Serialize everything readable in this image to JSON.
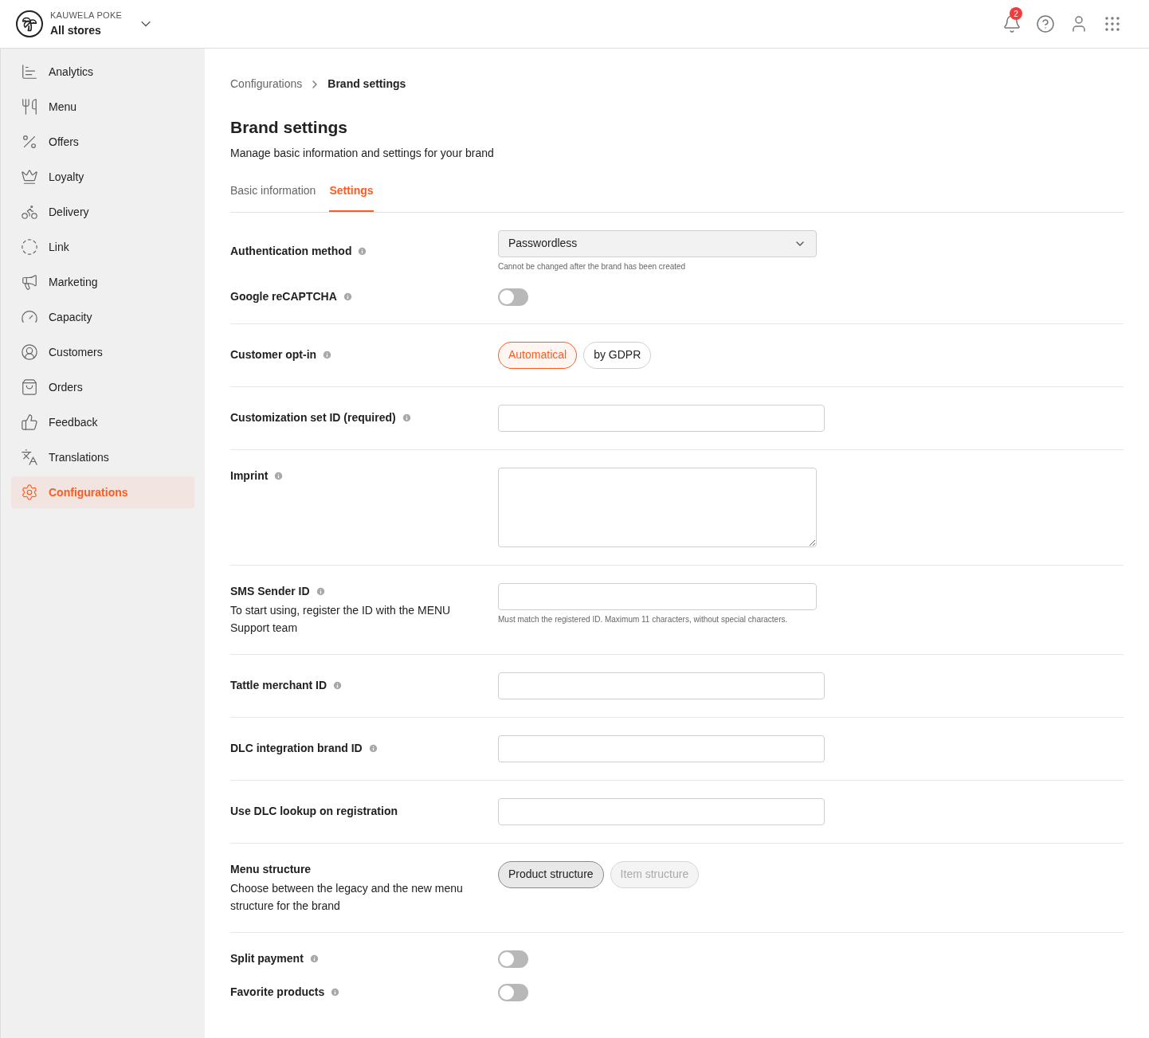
{
  "header": {
    "brand": "KAUWELA POKE",
    "store": "All stores",
    "notifications": "2"
  },
  "sidebar": {
    "items": [
      {
        "label": "Analytics",
        "selected": false
      },
      {
        "label": "Menu",
        "selected": false
      },
      {
        "label": "Offers",
        "selected": false
      },
      {
        "label": "Loyalty",
        "selected": false
      },
      {
        "label": "Delivery",
        "selected": false
      },
      {
        "label": "Link",
        "selected": false
      },
      {
        "label": "Marketing",
        "selected": false
      },
      {
        "label": "Capacity",
        "selected": false
      },
      {
        "label": "Customers",
        "selected": false
      },
      {
        "label": "Orders",
        "selected": false
      },
      {
        "label": "Feedback",
        "selected": false
      },
      {
        "label": "Translations",
        "selected": false
      },
      {
        "label": "Configurations",
        "selected": true
      }
    ]
  },
  "breadcrumb": [
    "Configurations",
    "Brand settings"
  ],
  "page": {
    "title": "Brand settings",
    "subtitle": "Manage basic information and settings for your brand"
  },
  "tabs": [
    {
      "label": "Basic information",
      "selected": false
    },
    {
      "label": "Settings",
      "selected": true
    }
  ],
  "sections": [
    {
      "rows": [
        {
          "kind": "select",
          "label": "Authentication method",
          "info": true,
          "value": "Passwordless",
          "hint": "Cannot be changed after the brand has been created"
        },
        {
          "kind": "toggle",
          "label": "Google reCAPTCHA",
          "info": true,
          "on": false
        }
      ]
    },
    {
      "rows": [
        {
          "kind": "choice",
          "label": "Customer opt-in",
          "info": true,
          "options": [
            {
              "label": "Automatical",
              "selected": true
            },
            {
              "label": "by GDPR",
              "selected": false
            }
          ]
        }
      ]
    },
    {
      "rows": [
        {
          "kind": "input",
          "label": "Customization set ID (required)",
          "info": true
        }
      ]
    },
    {
      "rows": [
        {
          "kind": "textarea",
          "label": "Imprint",
          "info": true
        }
      ]
    },
    {
      "rows": [
        {
          "kind": "input",
          "label": "SMS Sender ID",
          "info": true,
          "description": "To start using, register the ID with the MENU Support team",
          "hint": "Must match the registered ID. Maximum 11 characters, without special characters."
        }
      ]
    },
    {
      "rows": [
        {
          "kind": "input",
          "label": "Tattle merchant ID",
          "info": true
        }
      ]
    },
    {
      "rows": [
        {
          "kind": "input",
          "label": "DLC integration brand ID",
          "info": true
        }
      ]
    },
    {
      "rows": [
        {
          "kind": "input",
          "label": "Use DLC lookup on registration",
          "info": false
        }
      ]
    },
    {
      "rows": [
        {
          "kind": "choice",
          "label": "Menu structure",
          "info": false,
          "description": "Choose between the legacy and the new menu structure for the brand",
          "options": [
            {
              "label": "Product structure",
              "selected": true,
              "disabled": false
            },
            {
              "label": "Item structure",
              "selected": false,
              "disabled": true
            }
          ]
        }
      ]
    },
    {
      "rows": [
        {
          "kind": "toggle",
          "label": "Split payment",
          "info": true,
          "on": false
        },
        {
          "kind": "toggle",
          "label": "Favorite products",
          "info": true,
          "on": false
        }
      ]
    }
  ]
}
